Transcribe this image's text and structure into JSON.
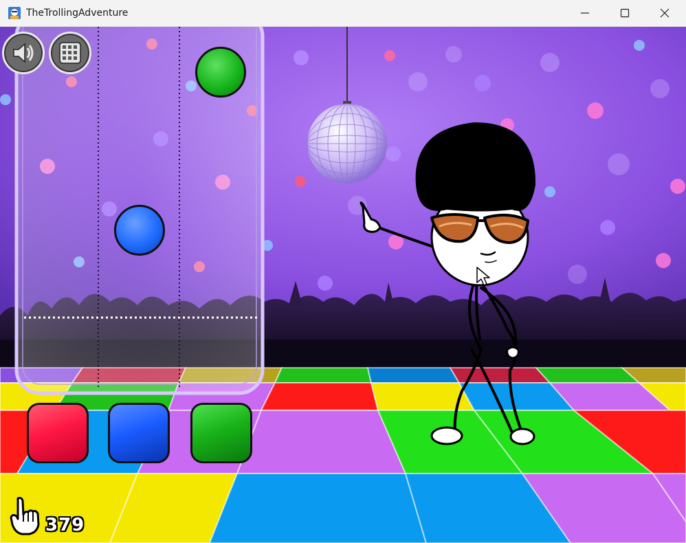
{
  "window": {
    "title": "TheTrollingAdventure",
    "controls": [
      "minimize-icon",
      "maximize-icon",
      "close-icon"
    ]
  },
  "game": {
    "ui_buttons": [
      {
        "name": "sound-icon"
      },
      {
        "name": "level-menu-icon"
      }
    ],
    "pads": [
      {
        "color_name": "red",
        "color": "#ff1744"
      },
      {
        "color_name": "blue",
        "color": "#1a5cff"
      },
      {
        "color_name": "green",
        "color": "#19b319"
      }
    ],
    "falling_notes": [
      {
        "lane": "blue",
        "color": "#1f6bff"
      },
      {
        "lane": "green",
        "color": "#16b51b"
      }
    ],
    "click_counter": {
      "icon": "hand-pointer-icon",
      "value": "379"
    },
    "colors": {
      "background_purple": "#8a4fe0",
      "floor_red": "#ff1a1a",
      "floor_green": "#22e01a",
      "floor_blue": "#0a9bf0",
      "floor_yellow": "#f5e800",
      "floor_purple": "#c86bf2"
    }
  }
}
